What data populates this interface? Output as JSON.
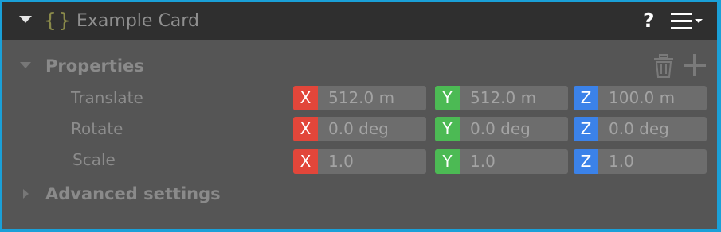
{
  "header": {
    "braces_icon": "{}",
    "title": "Example Card",
    "help_label": "?",
    "menu_icon": "hamburger-menu-with-caret"
  },
  "properties": {
    "title": "Properties",
    "actions": {
      "delete_icon": "trash-icon",
      "add_icon": "plus-icon"
    },
    "rows": [
      {
        "label": "Translate",
        "x": "512.0 m",
        "y": "512.0 m",
        "z": "100.0 m"
      },
      {
        "label": "Rotate",
        "x": "0.0 deg",
        "y": "0.0 deg",
        "z": "0.0 deg"
      },
      {
        "label": "Scale",
        "x": "1.0",
        "y": "1.0",
        "z": "1.0"
      }
    ],
    "axis_labels": {
      "x": "X",
      "y": "Y",
      "z": "Z"
    }
  },
  "advanced": {
    "title": "Advanced settings"
  },
  "colors": {
    "frame": "#1aa0d8",
    "header_bg": "#2f2f2f",
    "panel_bg": "#555555",
    "x_axis": "#e2463a",
    "y_axis": "#4cba54",
    "z_axis": "#3b82e9"
  }
}
